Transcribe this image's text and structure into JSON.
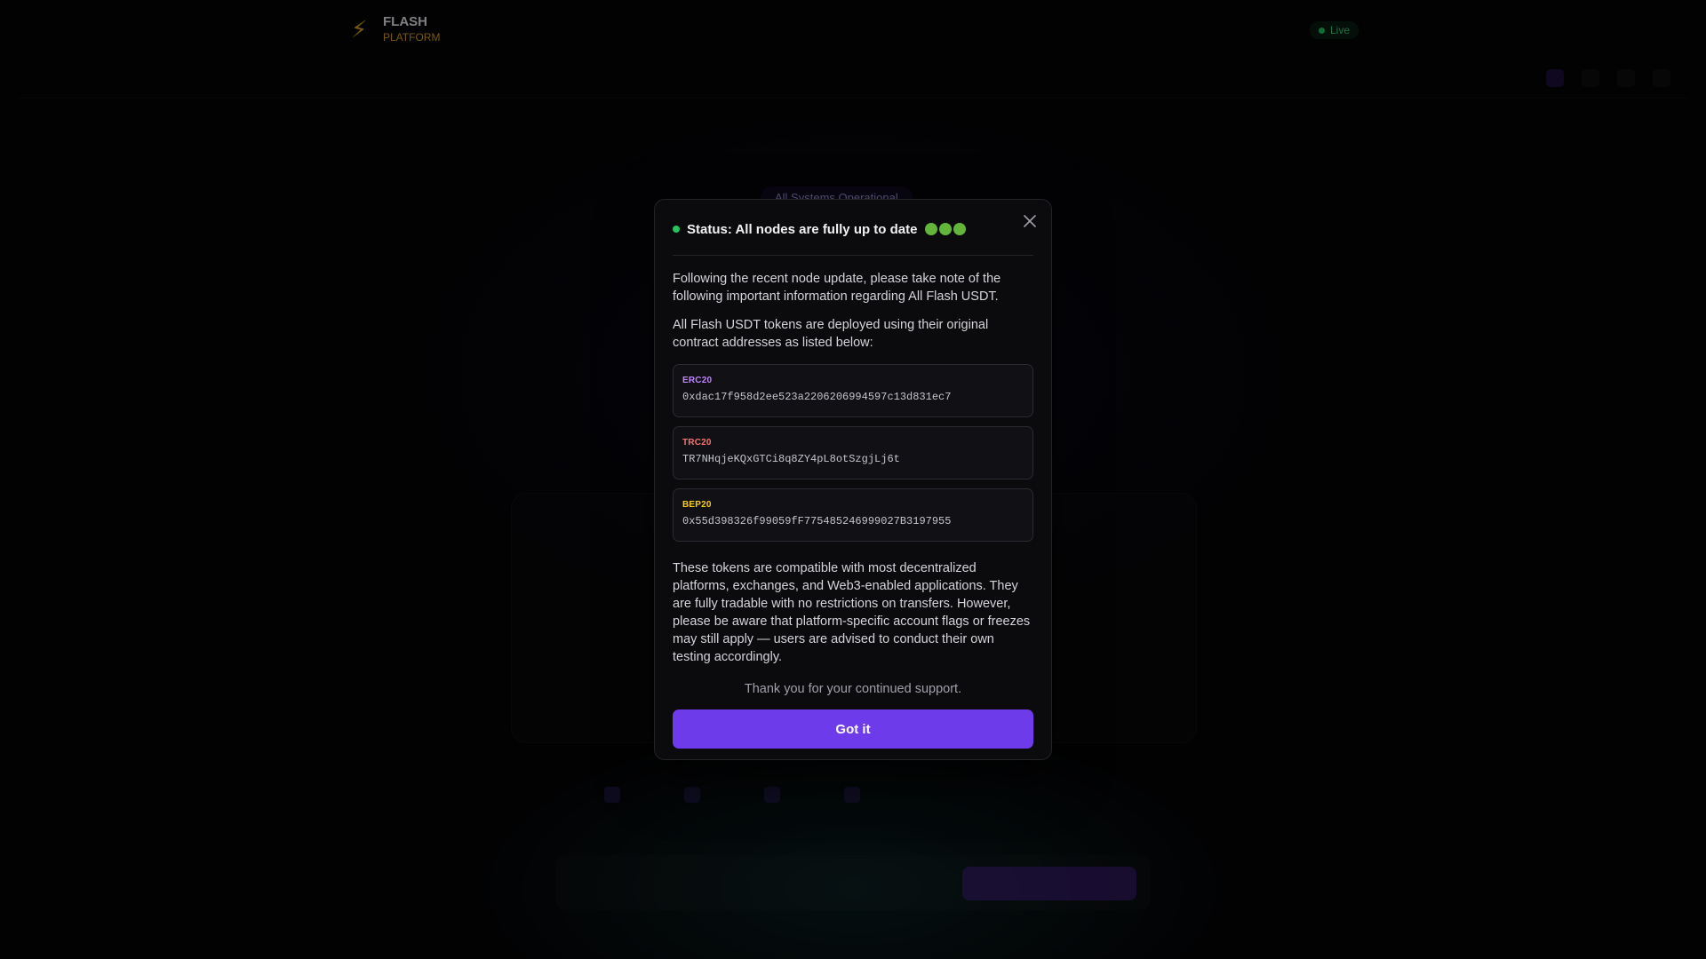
{
  "background": {
    "brand": {
      "name": "FLASH",
      "tagline": "PLATFORM"
    },
    "live_label": "Live",
    "hero_badge": "All Systems Operational"
  },
  "modal": {
    "status_text": "Status: All nodes are fully up to date",
    "intro": "Following the recent node update, please take note of the following important information regarding All Flash USDT.",
    "deploy_note": "All Flash USDT tokens are deployed using their original contract addresses as listed below:",
    "contracts": [
      {
        "network": "ERC20",
        "address": "0xdac17f958d2ee523a2206206994597c13d831ec7"
      },
      {
        "network": "TRC20",
        "address": "TR7NHqjeKQxGTCi8q8ZY4pL8otSzgjLj6t"
      },
      {
        "network": "BEP20",
        "address": "0x55d398326f99059fF775485246999027B3197955"
      }
    ],
    "compatibility": "These tokens are compatible with most decentralized platforms, exchanges, and Web3-enabled applications. They are fully tradable with no restrictions on transfers. However, please be aware that platform-specific account flags or freezes may still apply — users are advised to conduct their own testing accordingly.",
    "thanks": "Thank you for your continued support.",
    "confirm_label": "Got it",
    "icons": {
      "close": "close-icon"
    }
  },
  "colors": {
    "accent": "#6d3bea",
    "status_green": "#22c55e",
    "erc20": "#c084fc",
    "trc20": "#f87171",
    "bep20": "#facc15"
  }
}
